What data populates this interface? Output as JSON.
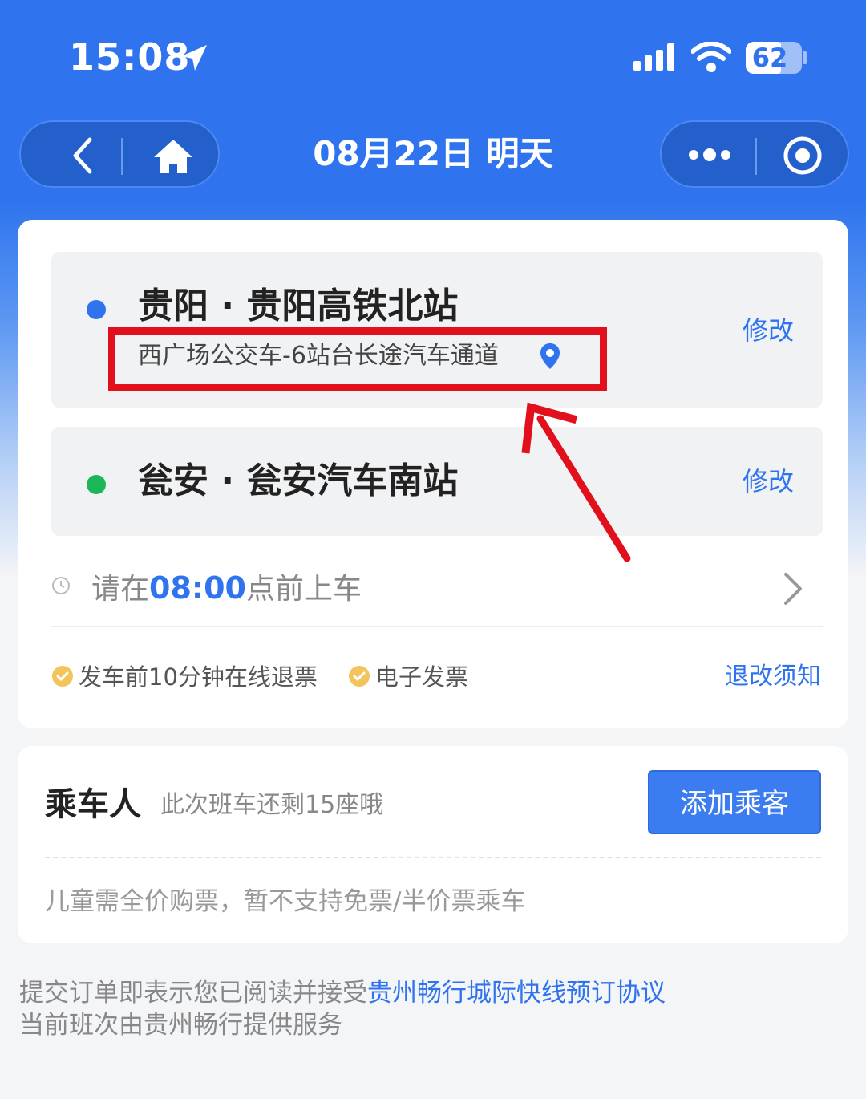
{
  "status_bar": {
    "time": "15:08",
    "battery": "62",
    "icons": [
      "location-arrow-icon",
      "signal-icon",
      "wifi-icon",
      "battery-icon"
    ]
  },
  "nav": {
    "title": "08月22日 明天",
    "icons": [
      "back-icon",
      "home-icon",
      "more-icon",
      "target-icon"
    ]
  },
  "route": {
    "origin": {
      "name": "贵阳 · 贵阳高铁北站",
      "sub": "西广场公交车-6站台长途汽车通道",
      "edit": "修改",
      "dot_color": "#2f74ee"
    },
    "destination": {
      "name": "瓮安 · 瓮安汽车南站",
      "edit": "修改",
      "dot_color": "#1ab657"
    },
    "boarding": {
      "prefix": "请在",
      "time": "08:00",
      "suffix": "点前上车"
    },
    "features": [
      "发车前10分钟在线退票",
      "电子发票"
    ],
    "rules_link": "退改须知"
  },
  "passengers": {
    "title": "乘车人",
    "seats_left": "此次班车还剩15座哦",
    "add_button": "添加乘客",
    "child_note": "儿童需全价购票，暂不支持免票/半价票乘车"
  },
  "footer": {
    "agree_prefix": "提交订单即表示您已阅读并接受",
    "agreement_link": "贵州畅行城际快线预订协议",
    "provider": "当前班次由贵州畅行提供服务"
  },
  "colors": {
    "accent": "#2f74ee",
    "highlight_red": "#e2101d"
  }
}
